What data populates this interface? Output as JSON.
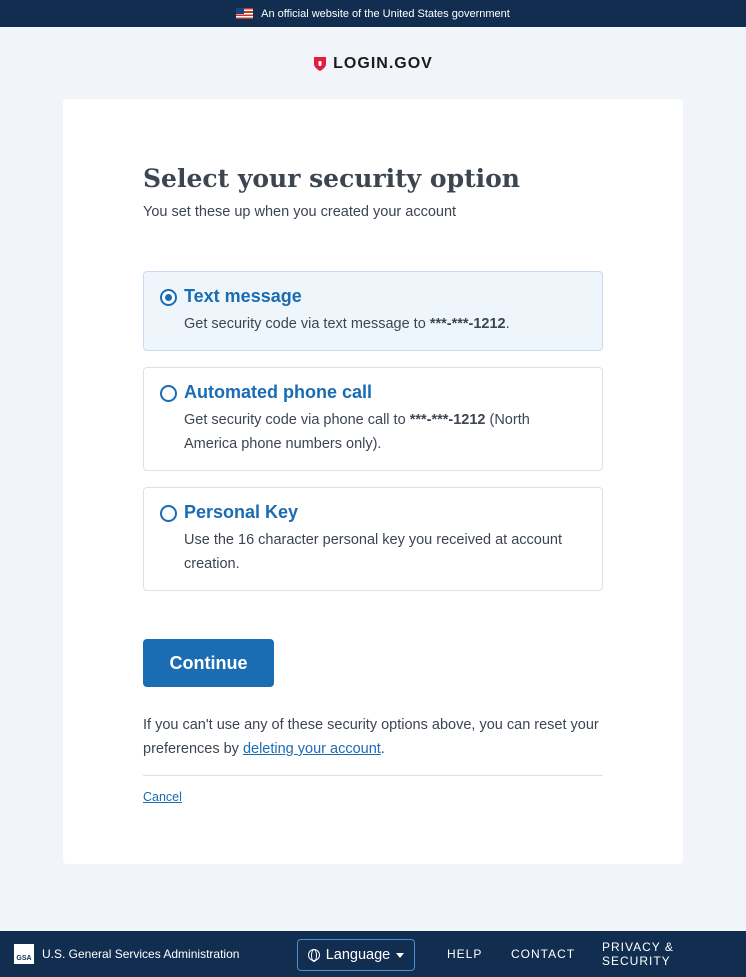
{
  "banner": {
    "text": "An official website of the United States government",
    "flag_icon": "us-flag-icon"
  },
  "logo": {
    "text": "LOGIN.GOV",
    "icon": "shield-icon",
    "color": "#e21c3d"
  },
  "main": {
    "title": "Select your security option",
    "subtitle": "You set these up when you created your account",
    "options": [
      {
        "label": "Text message",
        "desc_prefix": "Get security code via text message to ",
        "desc_bold": "***-***-1212",
        "desc_suffix": ".",
        "selected": true
      },
      {
        "label": "Automated phone call",
        "desc_prefix": "Get security code via phone call to ",
        "desc_bold": "***-***-1212",
        "desc_suffix": " (North America phone numbers only).",
        "selected": false
      },
      {
        "label": "Personal Key",
        "desc_prefix": "Use the 16 character personal key you received at account creation.",
        "desc_bold": "",
        "desc_suffix": "",
        "selected": false
      }
    ],
    "continue_label": "Continue",
    "reset_prefix": "If you can't use any of these security options above, you can reset your preferences by ",
    "reset_link": "deleting your account",
    "reset_suffix": ".",
    "cancel_label": "Cancel"
  },
  "footer": {
    "gsa_badge": "GSA",
    "agency": "U.S. General Services Administration",
    "language_label": "Language",
    "help": "HELP",
    "contact": "CONTACT",
    "privacy": "PRIVACY & SECURITY"
  },
  "colors": {
    "primary": "#1a6cb3",
    "navy": "#112e51",
    "selected_bg": "#eff6fb"
  }
}
